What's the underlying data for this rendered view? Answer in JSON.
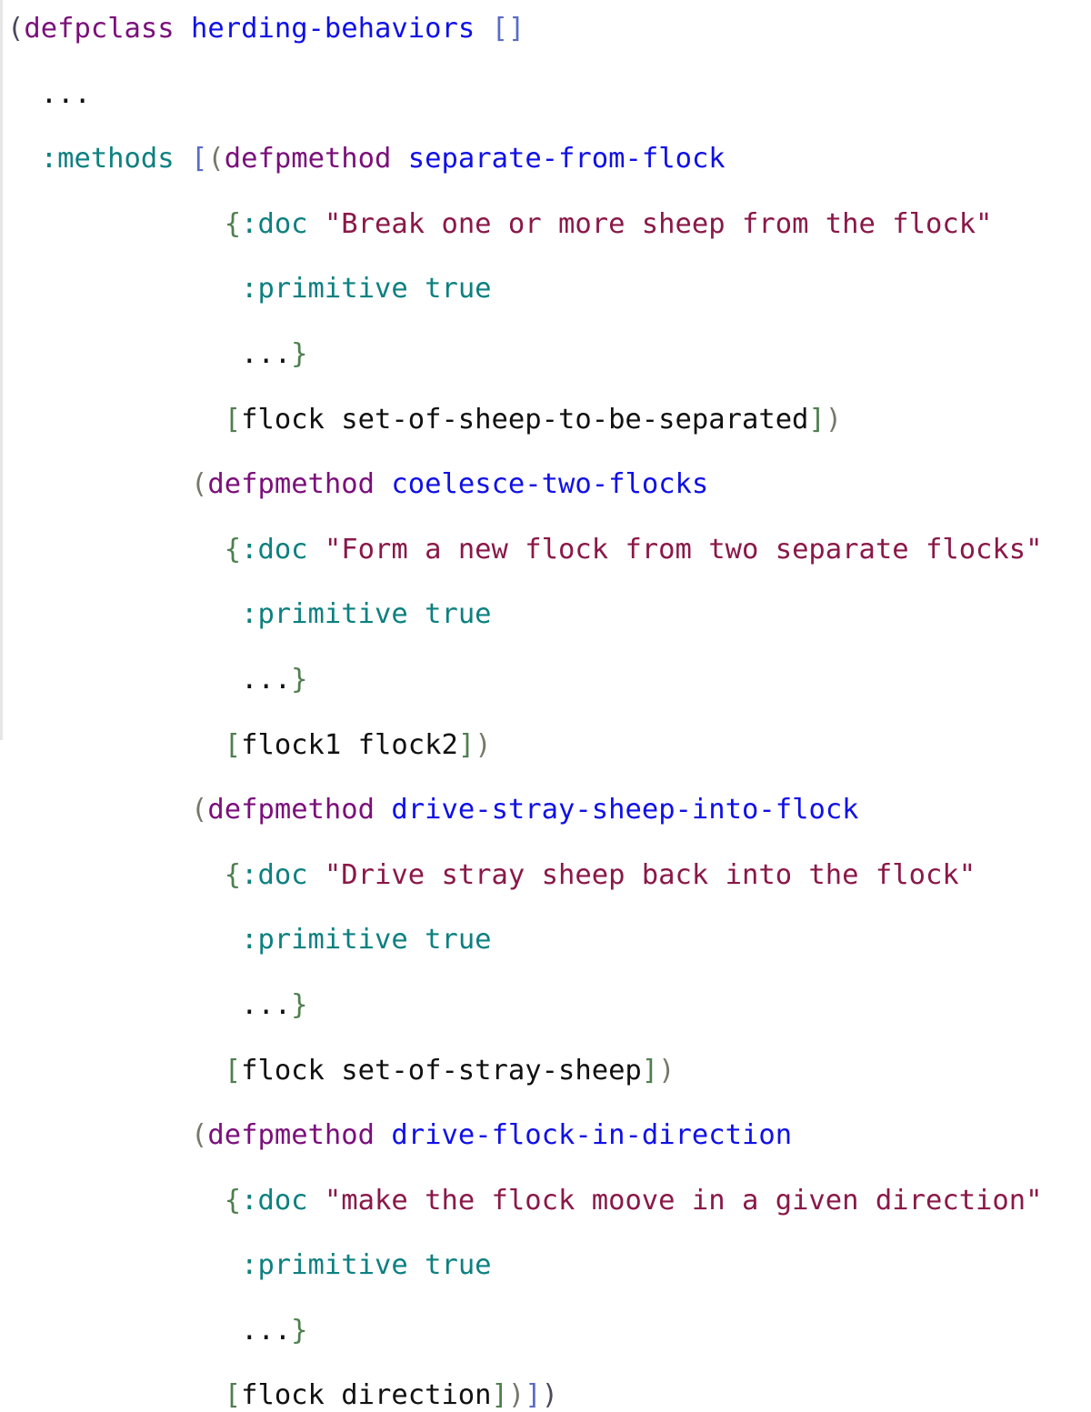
{
  "code": {
    "class_form": {
      "open": "(",
      "keyword": "defpclass",
      "name": "herding-behaviors",
      "superclasses": "[]"
    },
    "ellipsis": "...",
    "methods_key": ":methods",
    "methods_open": "[",
    "methods": [
      {
        "keyword": "defpmethod",
        "name": "separate-from-flock",
        "doc_key": ":doc",
        "doc": "\"Break one or more sheep from the flock\"",
        "prim_key": ":primitive",
        "prim_val": "true",
        "ellipsis": "...",
        "args": "flock set-of-sheep-to-be-separated"
      },
      {
        "keyword": "defpmethod",
        "name": "coelesce-two-flocks",
        "doc_key": ":doc",
        "doc": "\"Form a new flock from two separate flocks\"",
        "prim_key": ":primitive",
        "prim_val": "true",
        "ellipsis": "...",
        "args": "flock1 flock2"
      },
      {
        "keyword": "defpmethod",
        "name": "drive-stray-sheep-into-flock",
        "doc_key": ":doc",
        "doc": "\"Drive stray sheep back into the flock\"",
        "prim_key": ":primitive",
        "prim_val": "true",
        "ellipsis": "...",
        "args": "flock set-of-stray-sheep"
      },
      {
        "keyword": "defpmethod",
        "name": "drive-flock-in-direction",
        "doc_key": ":doc",
        "doc": "\"make the flock moove in a given direction\"",
        "prim_key": ":primitive",
        "prim_val": "true",
        "ellipsis": "...",
        "args": "flock direction"
      }
    ]
  }
}
